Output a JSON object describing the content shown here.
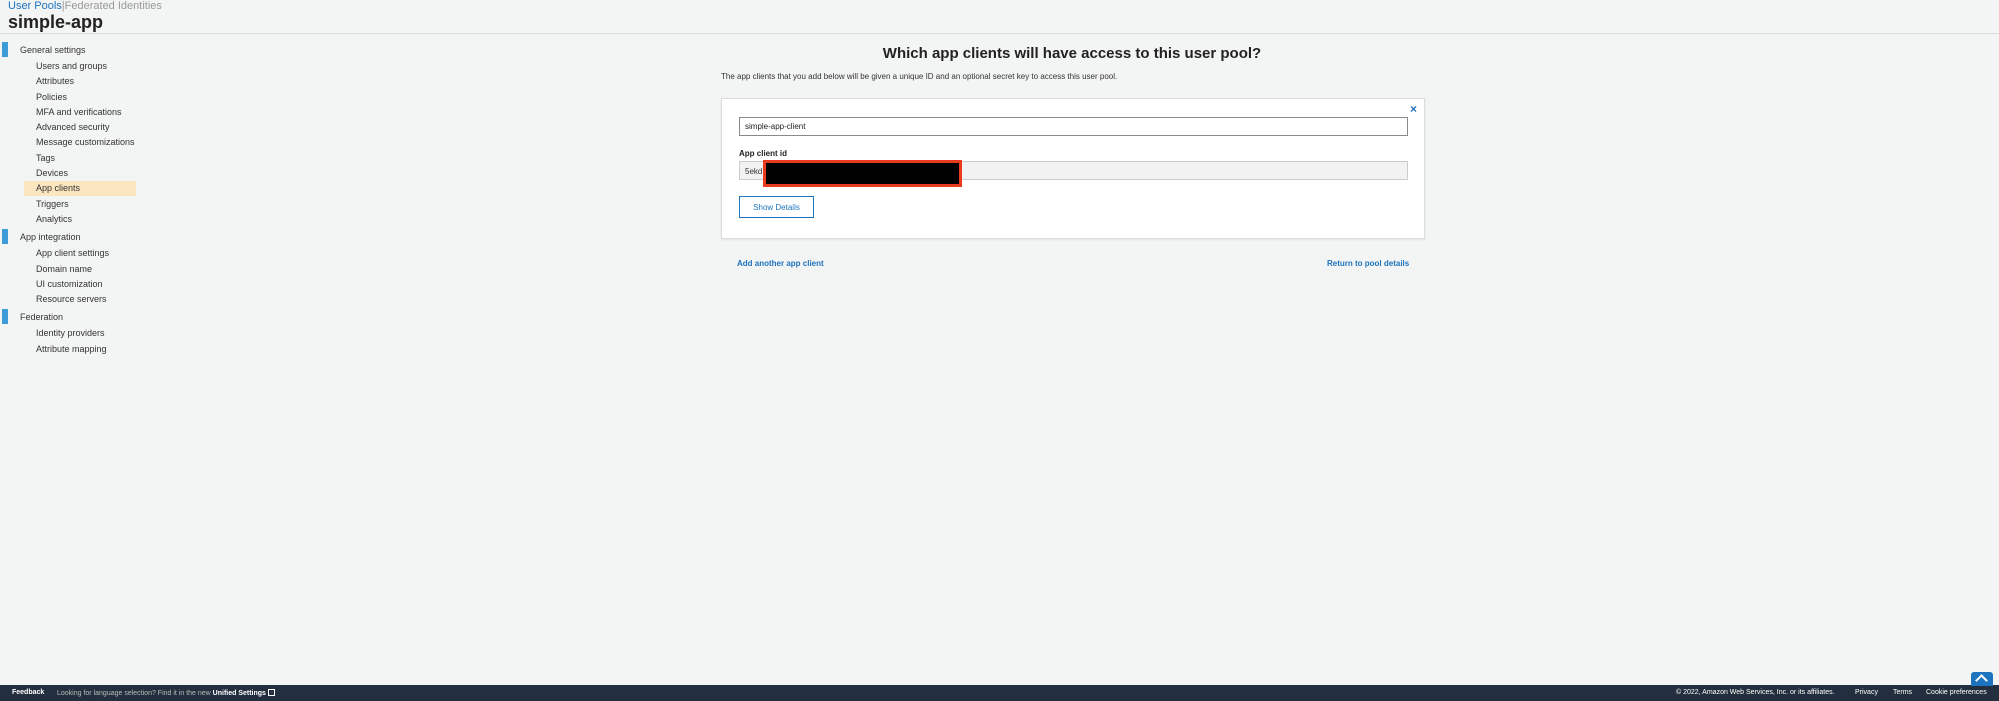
{
  "topnav": {
    "user_pools": "User Pools",
    "separator": "|",
    "federated": "Federated Identities"
  },
  "pool_name": "simple-app",
  "sidebar": {
    "sections": [
      {
        "label": "General settings",
        "items": [
          {
            "label": "Users and groups"
          },
          {
            "label": "Attributes"
          },
          {
            "label": "Policies"
          },
          {
            "label": "MFA and verifications"
          },
          {
            "label": "Advanced security"
          },
          {
            "label": "Message customizations"
          },
          {
            "label": "Tags"
          },
          {
            "label": "Devices"
          },
          {
            "label": "App clients",
            "selected": true
          },
          {
            "label": "Triggers"
          },
          {
            "label": "Analytics"
          }
        ]
      },
      {
        "label": "App integration",
        "items": [
          {
            "label": "App client settings"
          },
          {
            "label": "Domain name"
          },
          {
            "label": "UI customization"
          },
          {
            "label": "Resource servers"
          }
        ]
      },
      {
        "label": "Federation",
        "items": [
          {
            "label": "Identity providers"
          },
          {
            "label": "Attribute mapping"
          }
        ]
      }
    ]
  },
  "main": {
    "title": "Which app clients will have access to this user pool?",
    "description": "The app clients that you add below will be given a unique ID and an optional secret key to access this user pool.",
    "client": {
      "name_value": "simple-app-client",
      "id_label": "App client id",
      "id_value": "5ekd",
      "show_details": "Show Details",
      "close": "×"
    },
    "add_link": "Add another app client",
    "return_link": "Return to pool details"
  },
  "footer": {
    "feedback": "Feedback",
    "lang_text": "Looking for language selection? Find it in the new",
    "unified": "Unified Settings",
    "copyright": "© 2022, Amazon Web Services, Inc. or its affiliates.",
    "privacy": "Privacy",
    "terms": "Terms",
    "cookies": "Cookie preferences"
  },
  "colors": {
    "accent": "#1e73be",
    "section_bar": "#3d9bd8",
    "selected_bg": "#fbe6bf",
    "footer_bg": "#232f3e",
    "redaction": "#000000",
    "redaction_border": "#ea3b1f"
  }
}
